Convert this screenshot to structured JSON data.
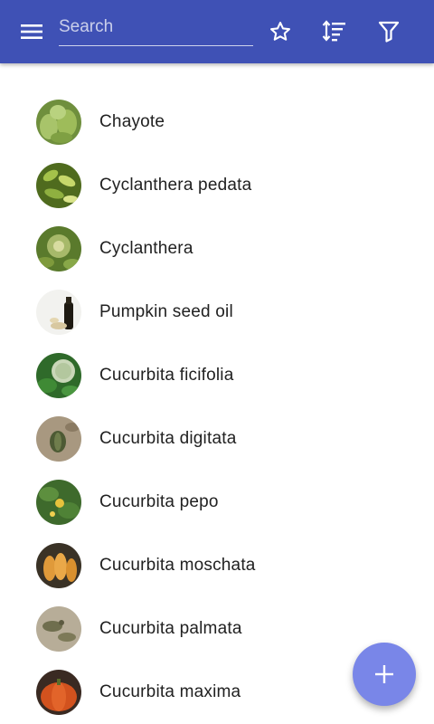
{
  "appbar": {
    "color": "#3f51b5",
    "menu_icon": "menu-icon",
    "search_placeholder": "Search",
    "actions": [
      "star-icon",
      "sort-icon",
      "filter-icon"
    ]
  },
  "items": [
    {
      "label": "Chayote"
    },
    {
      "label": "Cyclanthera pedata"
    },
    {
      "label": "Cyclanthera"
    },
    {
      "label": "Pumpkin seed oil"
    },
    {
      "label": "Cucurbita ficifolia"
    },
    {
      "label": "Cucurbita digitata"
    },
    {
      "label": "Cucurbita pepo"
    },
    {
      "label": "Cucurbita moschata"
    },
    {
      "label": "Cucurbita palmata"
    },
    {
      "label": "Cucurbita maxima"
    }
  ],
  "fab": {
    "icon": "plus-icon",
    "color": "#7986e8"
  }
}
